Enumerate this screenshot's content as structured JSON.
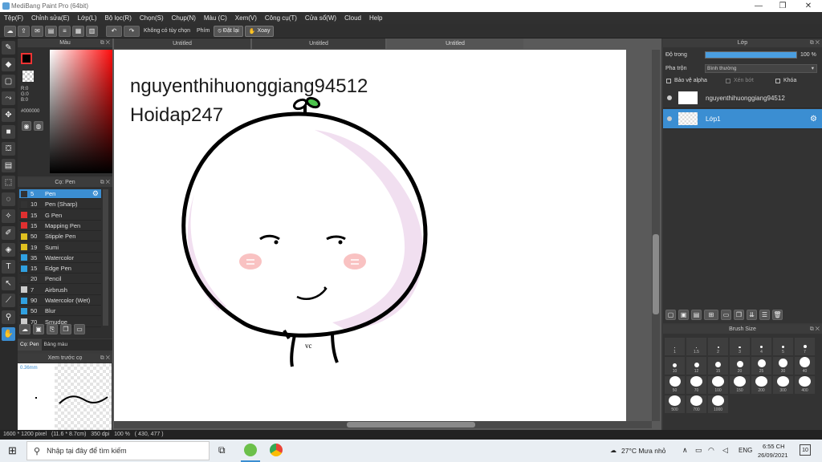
{
  "window": {
    "title": "MediBang Paint Pro (64bit)"
  },
  "menu": [
    "Tệp(F)",
    "Chỉnh sửa(E)",
    "Lớp(L)",
    "Bộ lọc(R)",
    "Chọn(S)",
    "Chụp(N)",
    "Màu (C)",
    "Xem(V)",
    "Công cụ(T)",
    "Cửa sổ(W)",
    "Cloud",
    "Help"
  ],
  "toolbar": {
    "selection_label": "Không có tùy chọn",
    "key_label": "Phím",
    "undo_all_label": "Đặt lại",
    "rotate_label": "Xoay"
  },
  "color_panel": {
    "title": "Màu",
    "r": "R:0",
    "g": "G:0",
    "b": "B:0",
    "hex": "#000000"
  },
  "brush_panel": {
    "title": "Cọ: Pen",
    "brushes": [
      {
        "size": "5",
        "name": "Pen",
        "color": "#333333",
        "selected": true
      },
      {
        "size": "10",
        "name": "Pen (Sharp)",
        "color": "#333333"
      },
      {
        "size": "15",
        "name": "G Pen",
        "color": "#e03030"
      },
      {
        "size": "15",
        "name": "Mapping Pen",
        "color": "#e03030"
      },
      {
        "size": "50",
        "name": "Stipple Pen",
        "color": "#e0c020"
      },
      {
        "size": "19",
        "name": "Sumi",
        "color": "#e0c020"
      },
      {
        "size": "35",
        "name": "Watercolor",
        "color": "#30a0e0"
      },
      {
        "size": "15",
        "name": "Edge Pen",
        "color": "#30a0e0"
      },
      {
        "size": "20",
        "name": "Pencil",
        "color": "#333333"
      },
      {
        "size": "7",
        "name": "Airbrush",
        "color": "#cccccc"
      },
      {
        "size": "90",
        "name": "Watercolor (Wet)",
        "color": "#30a0e0"
      },
      {
        "size": "50",
        "name": "Blur",
        "color": "#30a0e0"
      },
      {
        "size": "70",
        "name": "Smudge",
        "color": "#cccccc"
      }
    ],
    "tabs": [
      "Cọ: Pen",
      "Bảng màu"
    ]
  },
  "preview_panel": {
    "title": "Xem trước cọ",
    "size_label": "0.36mm"
  },
  "doc_tabs": [
    "Untitled",
    "Untitled",
    "Untitled"
  ],
  "canvas": {
    "line1": "nguyenthihuonggiang94512",
    "line2": "Hoidap247",
    "signature": "vc"
  },
  "layer_panel": {
    "title": "Lớp",
    "opacity_label": "Độ trong",
    "opacity_value": "100 %",
    "blend_label": "Pha trộn",
    "blend_value": "Bình thường",
    "protect_alpha": "Bảo vệ alpha",
    "clipping": "Xén bớt",
    "lock": "Khóa",
    "layers": [
      {
        "name": "nguyenthihuonggiang94512",
        "selected": false
      },
      {
        "name": "Lớp1",
        "selected": true
      }
    ]
  },
  "size_panel": {
    "title": "Brush Size",
    "sizes": [
      "1",
      "1.5",
      "2",
      "3",
      "4",
      "5",
      "7",
      "10",
      "12",
      "15",
      "20",
      "25",
      "30",
      "40",
      "50",
      "70",
      "100",
      "150",
      "200",
      "300",
      "400",
      "500",
      "700",
      "1000"
    ]
  },
  "status": {
    "dimensions": "1600 * 1200 pixel",
    "physical": "(11.6 * 8.7cm)",
    "dpi": "350 dpi",
    "zoom": "100 %",
    "cursor": "( 430, 477 )"
  },
  "taskbar": {
    "search_placeholder": "Nhập tại đây để tìm kiếm",
    "weather": "27°C  Mưa nhỏ",
    "lang": "ENG",
    "time": "6:55 CH",
    "date": "26/09/2021",
    "notif": "10"
  }
}
